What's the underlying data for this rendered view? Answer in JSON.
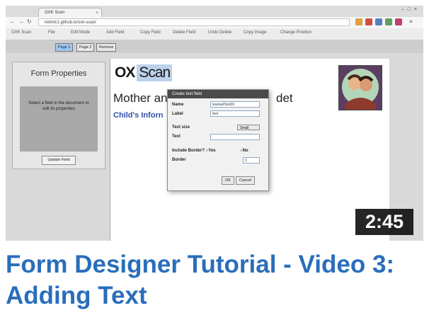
{
  "video": {
    "title": "Form Designer Tutorial - Video 3: Adding Text",
    "duration": "2:45"
  },
  "browser": {
    "tab_title": "OXK Scan",
    "url": "netmlc1.github.io/oxk-scan/"
  },
  "app": {
    "menu": [
      "OXK Scan",
      "File",
      "Edit Mode",
      "Add Field",
      "Copy Field",
      "Delete Field",
      "Undo Delete",
      "Copy Image",
      "Change Position"
    ],
    "pages": [
      {
        "label": "Page 1",
        "selected": true
      },
      {
        "label": "Page 2",
        "selected": false
      }
    ],
    "remove_label": "Remove"
  },
  "form_properties": {
    "title": "Form Properties",
    "hint": "Select a field in the document to edit its properties",
    "update_label": "Update Field"
  },
  "document": {
    "logo_prefix": "OX",
    "logo_suffix": "Scan",
    "title_left": "Mother an",
    "title_right": "det",
    "subtitle": "Child's Inforn"
  },
  "dialog": {
    "title": "Create text field",
    "name_label": "Name",
    "name_value": "learnedText01",
    "label_label": "Label",
    "label_value": "text",
    "text_size_label": "Text size",
    "text_size_value": "Small",
    "text_label": "Text",
    "text_value": "",
    "border_question": "Include Border? ",
    "border_yes": "Yes",
    "border_no": "No",
    "border_label": "Border",
    "border_value": "1",
    "ok_label": "OK",
    "cancel_label": "Cancel"
  },
  "colors": {
    "caption": "#2a6ebb",
    "subtitle": "#2f4fa8"
  }
}
